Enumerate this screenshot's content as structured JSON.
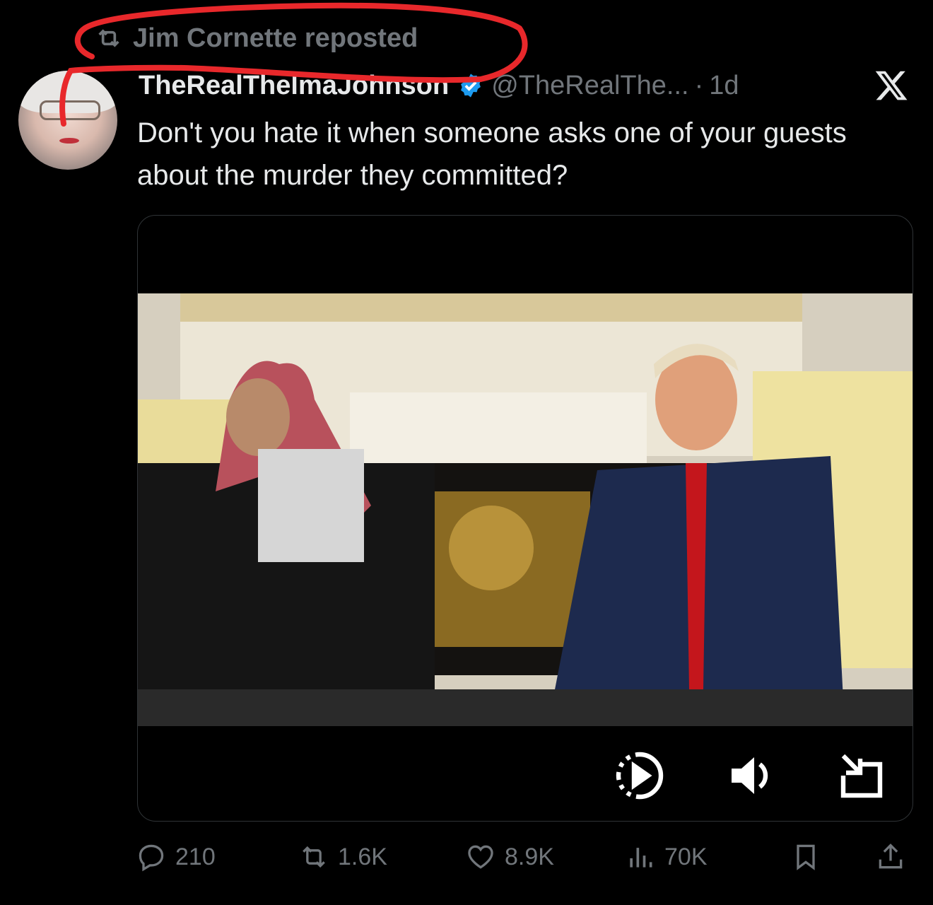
{
  "repost": {
    "label": "Jim Cornette reposted",
    "icon": "repost-icon"
  },
  "author": {
    "display_name": "TheRealThelmaJohnson",
    "handle": "@TheRealThe...",
    "time": "1d",
    "separator": "·"
  },
  "tweet": {
    "text": "Don't you hate it when someone asks one of your guests about the murder they committed?"
  },
  "video": {
    "controls": [
      "play-icon",
      "volume-icon",
      "expand-icon"
    ]
  },
  "actions": {
    "replies": "210",
    "reposts": "1.6K",
    "likes": "8.9K",
    "views": "70K"
  },
  "colors": {
    "background": "#000000",
    "text": "#e7e9ea",
    "muted": "#71767b",
    "verified": "#1d9bf0",
    "annotation": "#e8282b"
  }
}
